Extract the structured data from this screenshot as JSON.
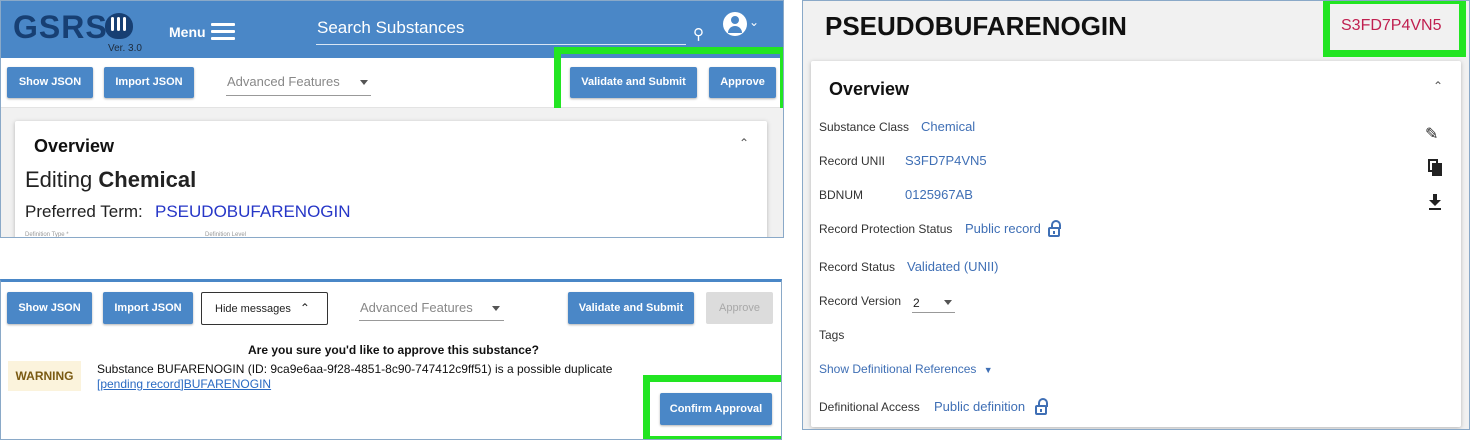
{
  "colors": {
    "primary": "#4a87c7",
    "highlight": "#22e522",
    "link": "#3f6fb5",
    "unii": "#c02050"
  },
  "editor": {
    "logo": "GSRS",
    "version": "Ver. 3.0",
    "menu_label": "Menu",
    "search_placeholder": "Search Substances",
    "toolbar": {
      "show_json": "Show JSON",
      "import_json": "Import JSON",
      "advanced": "Advanced Features",
      "validate": "Validate and Submit",
      "approve": "Approve"
    },
    "overview": {
      "title": "Overview",
      "editing_word": "Editing",
      "editing_type": "Chemical",
      "preferred_label": "Preferred Term:",
      "preferred_value": "PSEUDOBUFARENOGIN",
      "def_type": "Definition Type *",
      "def_level": "Definition Level"
    }
  },
  "confirm": {
    "toolbar": {
      "show_json": "Show JSON",
      "import_json": "Import JSON",
      "hide_messages": "Hide messages",
      "advanced": "Advanced Features",
      "validate": "Validate and Submit",
      "approve": "Approve"
    },
    "question": "Are you sure you'd like to approve this substance?",
    "warning_badge": "WARNING",
    "warning_message": "Substance BUFARENOGIN (ID: 9ca9e6aa-9f28-4851-8c90-747412c9ff51) is a possible duplicate",
    "warning_link": "[pending record]BUFARENOGIN",
    "confirm_button": "Confirm Approval"
  },
  "record": {
    "name": "PSEUDOBUFARENOGIN",
    "unii_header": "S3FD7P4VN5",
    "overview_title": "Overview",
    "fields": {
      "substance_class_label": "Substance Class",
      "substance_class": "Chemical",
      "unii_label": "Record UNII",
      "unii": "S3FD7P4VN5",
      "bdnum_label": "BDNUM",
      "bdnum": "0125967AB",
      "protection_label": "Record Protection Status",
      "protection": "Public record",
      "status_label": "Record Status",
      "status": "Validated (UNII)",
      "version_label": "Record Version",
      "version": "2",
      "tags_label": "Tags",
      "def_refs": "Show Definitional References",
      "def_access_label": "Definitional Access",
      "def_access": "Public definition"
    }
  }
}
